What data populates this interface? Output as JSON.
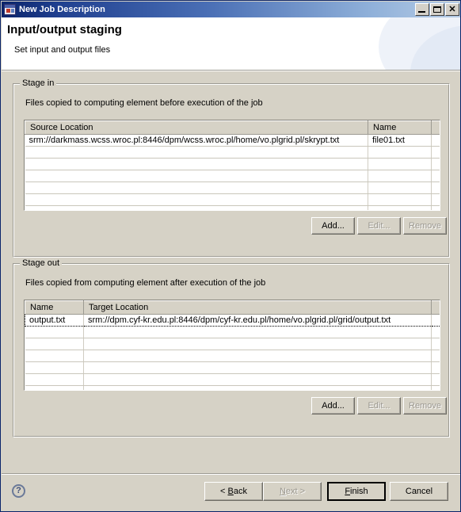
{
  "window": {
    "title": "New Job Description",
    "app_icon": "application-window-icon",
    "controls": {
      "minimize": "minimize-icon",
      "maximize": "maximize-icon",
      "close": "✕"
    }
  },
  "header": {
    "title": "Input/output staging",
    "subtitle": "Set input and output files"
  },
  "stage_in": {
    "group_title": "Stage in",
    "description": "Files copied to computing element before execution of the job",
    "columns": [
      "Source Location",
      "Name",
      ""
    ],
    "rows": [
      [
        "srm://darkmass.wcss.wroc.pl:8446/dpm/wcss.wroc.pl/home/vo.plgrid.pl/skrypt.txt",
        "file01.txt",
        ""
      ]
    ],
    "empty_row_count": 6,
    "buttons": {
      "add": "Add...",
      "edit": "Edit...",
      "remove": "Remove"
    },
    "button_states": {
      "add": "enabled",
      "edit": "disabled",
      "remove": "disabled"
    }
  },
  "stage_out": {
    "group_title": "Stage out",
    "description": "Files copied from computing element after execution of the job",
    "columns": [
      "Name",
      "Target Location",
      ""
    ],
    "rows": [
      [
        "output.txt",
        "srm://dpm.cyf-kr.edu.pl:8446/dpm/cyf-kr.edu.pl/home/vo.plgrid.pl/grid/output.txt",
        ""
      ]
    ],
    "empty_row_count": 6,
    "selected_row_index": 0,
    "buttons": {
      "add": "Add...",
      "edit": "Edit...",
      "remove": "Remove"
    },
    "button_states": {
      "add": "enabled",
      "edit": "disabled",
      "remove": "disabled"
    }
  },
  "footer": {
    "help_icon": "?",
    "back": "< Back",
    "next": "Next >",
    "finish": "Finish",
    "cancel": "Cancel",
    "back_mnemonic": "B",
    "next_mnemonic": "N",
    "finish_mnemonic": "F",
    "states": {
      "back": "enabled",
      "next": "disabled",
      "finish": "enabled-default",
      "cancel": "enabled"
    }
  },
  "colors": {
    "titlebar_start": "#0a246a",
    "titlebar_end": "#b6cce6",
    "dialog_face": "#d6d2c6",
    "header_background": "#ffffff",
    "help_icon": "#41507a"
  }
}
